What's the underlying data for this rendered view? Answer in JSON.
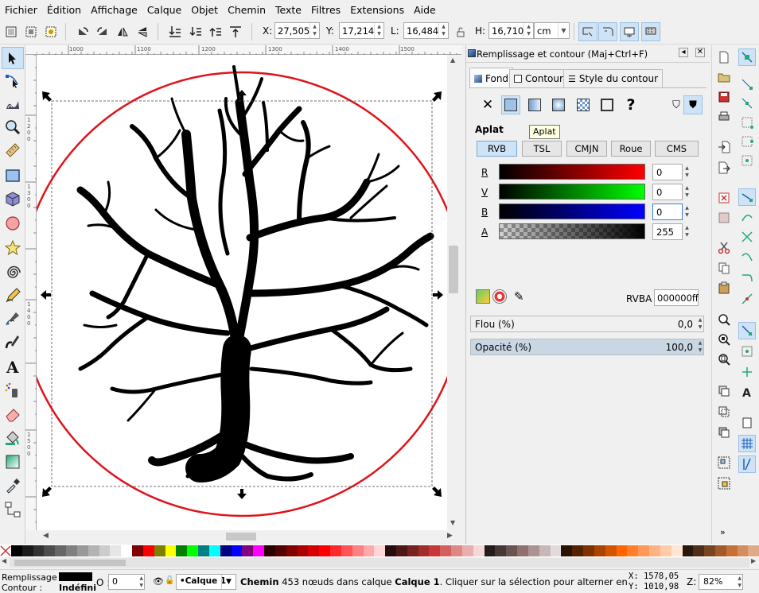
{
  "menu": [
    "Fichier",
    "Édition",
    "Affichage",
    "Calque",
    "Objet",
    "Chemin",
    "Texte",
    "Filtres",
    "Extensions",
    "Aide"
  ],
  "toolbar": {
    "x_label": "X:",
    "x_value": "27,505",
    "y_label": "Y:",
    "y_value": "17,214",
    "w_label": "L:",
    "w_value": "16,484",
    "h_label": "H:",
    "h_value": "16,710",
    "unit": "cm"
  },
  "ruler": {
    "marks": [
      "1000",
      "1100",
      "1200",
      "1300",
      "1400",
      "1500"
    ],
    "left_marks": [
      "1",
      "2",
      "0",
      "0",
      "1",
      "3",
      "0",
      "0",
      "1",
      "4",
      "0",
      "0",
      "1",
      "5",
      "0",
      "0",
      "1",
      "6",
      "0",
      "0"
    ]
  },
  "dialog": {
    "title": "Remplissage et contour (Maj+Ctrl+F)",
    "tabs": [
      "Fond",
      "Contour",
      "Style du contour"
    ],
    "section": "Aplat",
    "tooltip": "Aplat",
    "modes": [
      "RVB",
      "TSL",
      "CMJN",
      "Roue",
      "CMS"
    ],
    "channels": [
      {
        "label": "R",
        "value": "0",
        "color": "#ff0000"
      },
      {
        "label": "V",
        "value": "0",
        "color": "#00ff00"
      },
      {
        "label": "B",
        "value": "0",
        "color": "#0000ff"
      },
      {
        "label": "A",
        "value": "255",
        "color": "#000000"
      }
    ],
    "rgba_label": "RVBA :",
    "rgba_value": "000000ff",
    "blur_label": "Flou (%)",
    "blur_value": "0,0",
    "opacity_label": "Opacité (%)",
    "opacity_value": "100,0"
  },
  "status": {
    "fill_label": "Remplissage :",
    "stroke_label": "Contour :",
    "stroke_value": "Indéfini",
    "opacity_label": "O :",
    "opacity_value": "0",
    "layer": "•Calque 1",
    "msg_bold1": "Chemin",
    "msg_mid": " 453 nœuds dans calque ",
    "msg_bold2": "Calque 1",
    "msg_end": ". Cliquer sur la sélection pour alterner entre poignées",
    "coord_x": "X: 1578,05",
    "coord_y": "Y: 1010,98",
    "zoom_label": "Z:",
    "zoom_value": "82%"
  },
  "palette": [
    "#000000",
    "#1a1a1a",
    "#333333",
    "#4d4d4d",
    "#666666",
    "#808080",
    "#999999",
    "#b3b3b3",
    "#cccccc",
    "#e6e6e6",
    "#ffffff",
    "#800000",
    "#ff0000",
    "#808000",
    "#ffff00",
    "#008000",
    "#00ff00",
    "#008080",
    "#00ffff",
    "#000080",
    "#0000ff",
    "#800080",
    "#ff00ff",
    "#2b0000",
    "#550000",
    "#800000",
    "#aa0000",
    "#d40000",
    "#ff0000",
    "#ff2a2a",
    "#ff5555",
    "#ff8080",
    "#ffaaaa",
    "#ffd5d5",
    "#280b0b",
    "#501616",
    "#782121",
    "#a02c2c",
    "#c83737",
    "#d35f5f",
    "#de8787",
    "#e9afaf",
    "#f4d7d7",
    "#241c1c",
    "#483737",
    "#6c5353",
    "#916f6f",
    "#ac9393",
    "#c8b7b7",
    "#e3dbdb",
    "#2b1100",
    "#552200",
    "#803300",
    "#aa4400",
    "#d45500",
    "#ff6600",
    "#ff7f2a",
    "#ff9955",
    "#ffb380",
    "#ffccaa",
    "#ffe6d5",
    "#28170b",
    "#502d16",
    "#784421",
    "#a05a2c",
    "#c87137",
    "#d38d5f",
    "#deaa87"
  ]
}
